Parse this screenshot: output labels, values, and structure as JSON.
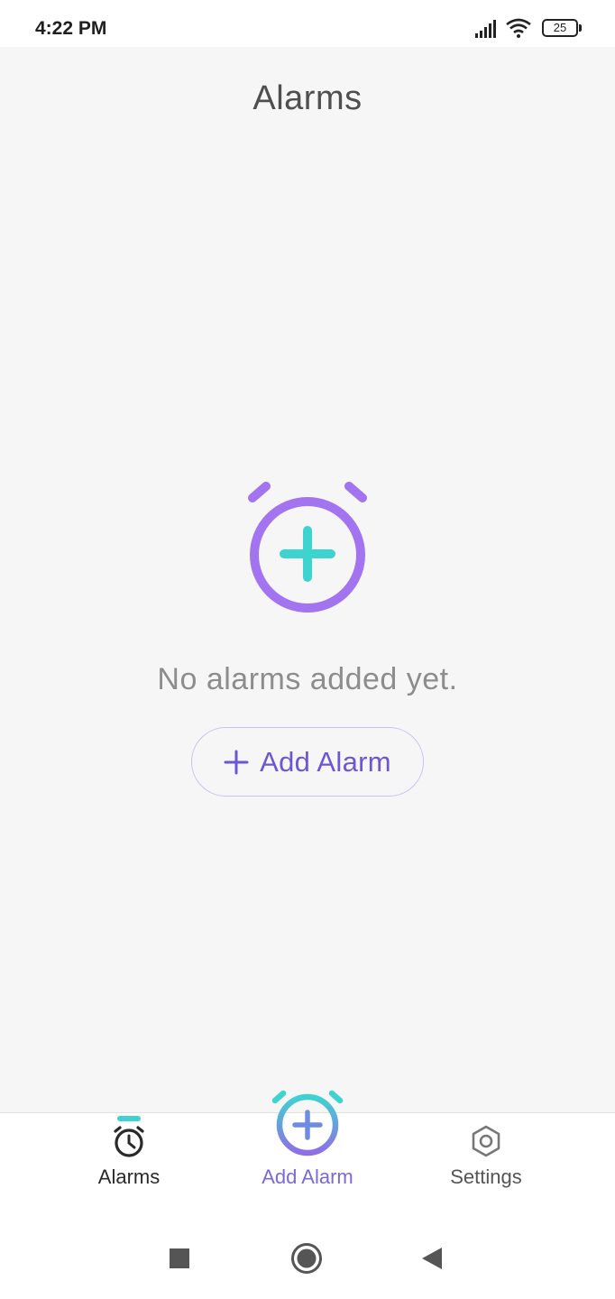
{
  "status_bar": {
    "time": "4:22 PM",
    "battery_level": "25",
    "icons": [
      "signal-icon",
      "wifi-icon",
      "battery-icon"
    ]
  },
  "header": {
    "title": "Alarms"
  },
  "empty_state": {
    "icon": "alarm-add-icon",
    "message": "No alarms added yet.",
    "button_label": "Add Alarm"
  },
  "bottom_nav": {
    "items": [
      {
        "label": "Alarms",
        "icon": "alarm-clock-icon",
        "selected": true
      },
      {
        "label": "Add Alarm",
        "icon": "alarm-add-icon"
      },
      {
        "label": "Settings",
        "icon": "gear-icon"
      }
    ]
  },
  "system_nav": {
    "icons": [
      "recents-square-icon",
      "home-circle-icon",
      "back-triangle-icon"
    ]
  },
  "colors": {
    "accent_purple": "#6b57d6",
    "accent_teal": "#3fd3d0",
    "icon_purple": "#a274f0",
    "background": "#f6f6f7"
  }
}
